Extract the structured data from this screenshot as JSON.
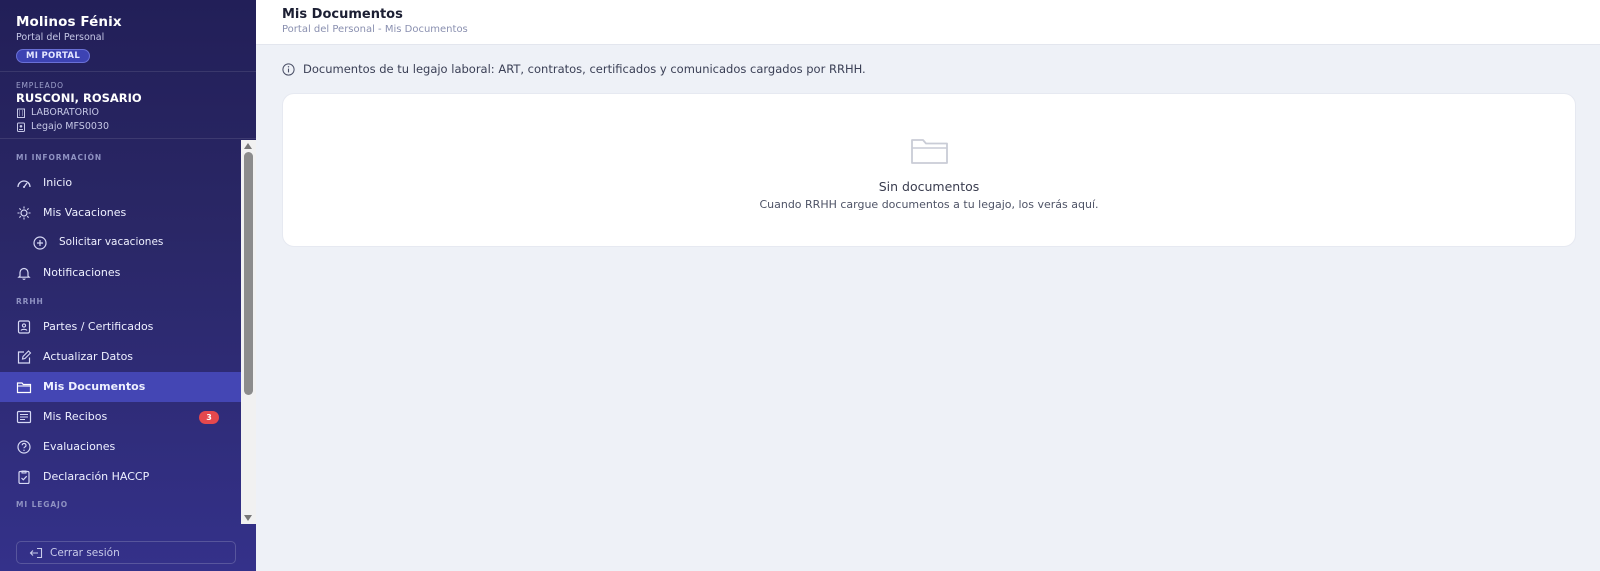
{
  "brand": {
    "name": "Molinos Fénix",
    "subtitle": "Portal del Personal",
    "badge": "MI PORTAL"
  },
  "employee": {
    "caption": "EMPLEADO",
    "name": "RUSCONI, ROSARIO",
    "department": "LABORATORIO",
    "legajo": "Legajo MFS0030"
  },
  "sidebar": {
    "sections": [
      {
        "title": "MI INFORMACIÓN"
      },
      {
        "title": "RRHH"
      },
      {
        "title": "MI LEGAJO"
      }
    ],
    "items": [
      {
        "label": "Inicio",
        "icon": "gauge-icon"
      },
      {
        "label": "Mis Vacaciones",
        "icon": "sun-icon"
      },
      {
        "label": "Solicitar vacaciones",
        "icon": "plus-circle-icon"
      },
      {
        "label": "Notificaciones",
        "icon": "bell-icon"
      },
      {
        "label": "Partes / Certificados",
        "icon": "id-card-icon"
      },
      {
        "label": "Actualizar Datos",
        "icon": "edit-icon"
      },
      {
        "label": "Mis Documentos",
        "icon": "folder-icon",
        "active": true
      },
      {
        "label": "Mis Recibos",
        "icon": "receipt-icon",
        "badge": "3"
      },
      {
        "label": "Evaluaciones",
        "icon": "question-circle-icon"
      },
      {
        "label": "Declaración HACCP",
        "icon": "clipboard-check-icon"
      }
    ],
    "logout_label": "Cerrar sesión"
  },
  "header": {
    "title": "Mis Documentos",
    "breadcrumb": "Portal del Personal - Mis Documentos"
  },
  "main": {
    "info_text": "Documentos de tu legajo laboral: ART, contratos, certificados y comunicados cargados por RRHH.",
    "empty_title": "Sin documentos",
    "empty_subtitle": "Cuando RRHH cargue documentos a tu legajo, los verás aquí."
  },
  "colors": {
    "sidebar_bg": "#2a2766",
    "active_item": "#4446b4",
    "badge_red": "#e5484d",
    "page_bg": "#eef1f7"
  }
}
